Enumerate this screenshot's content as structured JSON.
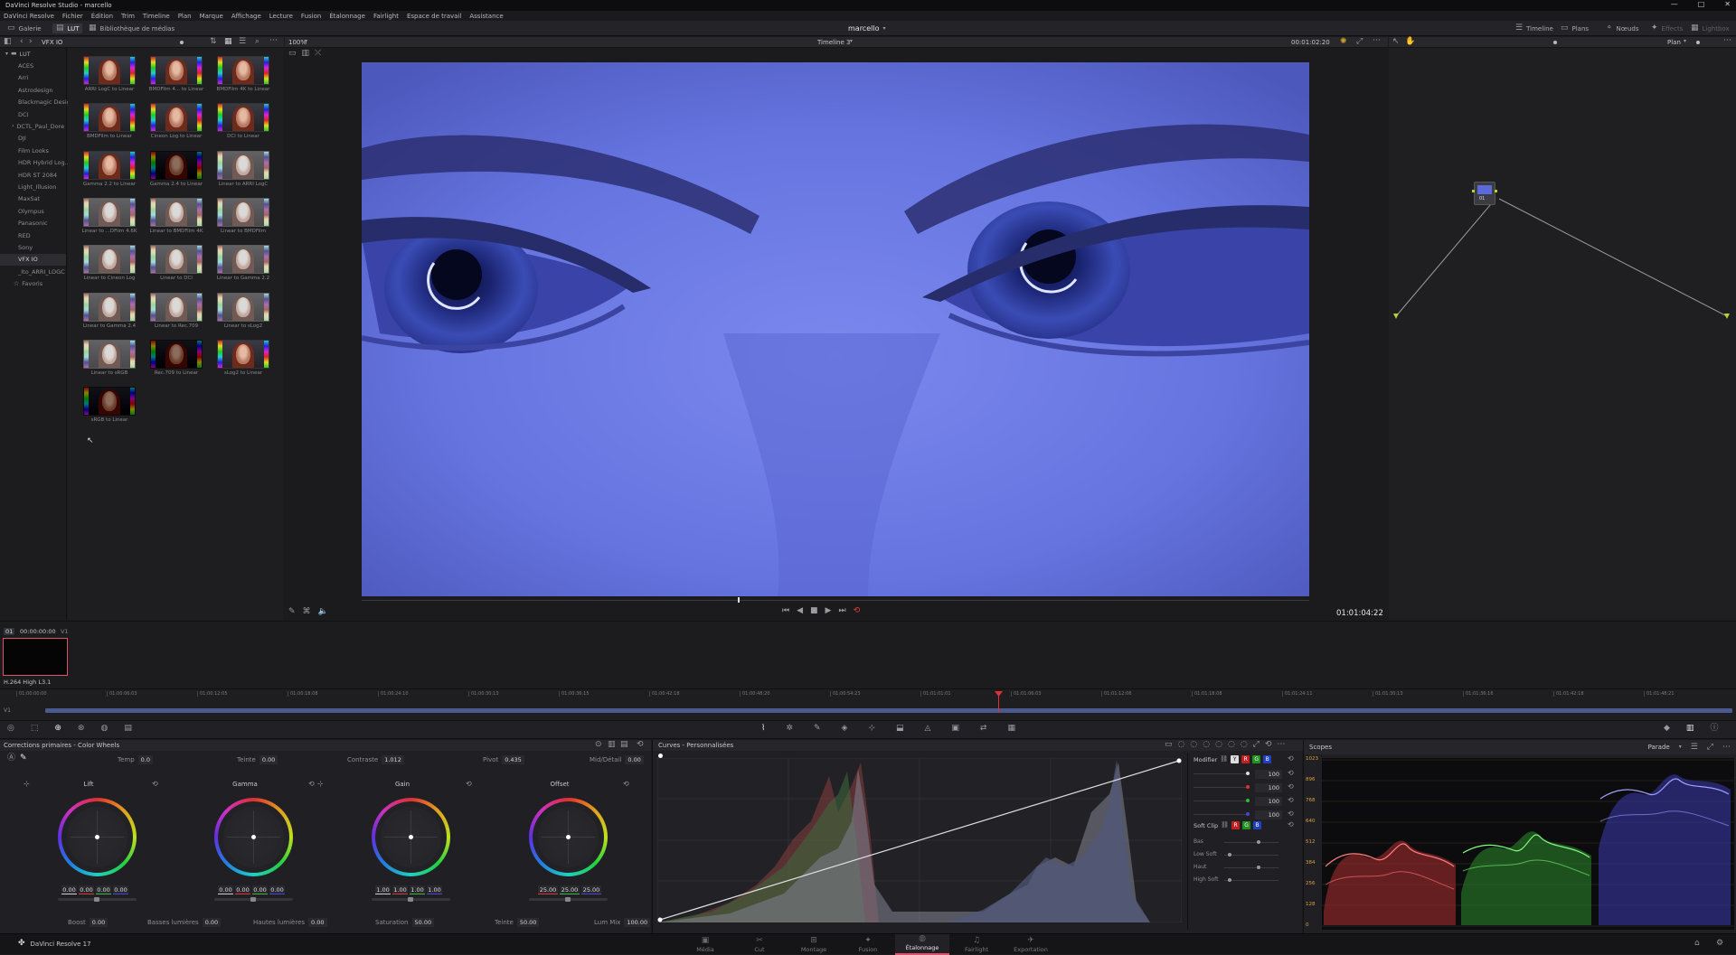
{
  "window": {
    "title": "DaVinci Resolve Studio - marcello",
    "controls": [
      "—",
      "□",
      "✕"
    ]
  },
  "menu": [
    "DaVinci Resolve",
    "Fichier",
    "Édition",
    "Trim",
    "Timeline",
    "Plan",
    "Marque",
    "Affichage",
    "Lecture",
    "Fusion",
    "Étalonnage",
    "Fairlight",
    "Espace de travail",
    "Assistance"
  ],
  "toolbar": {
    "gallery": "Galerie",
    "lut": "LUT",
    "media_library": "Bibliothèque de médias",
    "project_name": "marcello",
    "right": [
      "Timeline",
      "Plans",
      "Nœuds",
      "Effects",
      "Lightbox"
    ]
  },
  "lut_browser": {
    "header": "VFX IO",
    "root": "LUT",
    "folders": [
      "ACES",
      "Arri",
      "Astrodesign",
      "Blackmagic Design",
      "DCI",
      "DCTL_Paul_Dore",
      "DJI",
      "Film Looks",
      "HDR Hybrid Log...",
      "HDR ST 2084",
      "Light_Illusion",
      "MaxSat",
      "Olympus",
      "Panasonic",
      "RED",
      "Sony",
      "VFX IO",
      "_Ito_ARRI_LOGC",
      "Favoris"
    ],
    "selected_folder": "VFX IO",
    "luts": [
      "ARRI LogC to Linear",
      "BMDFilm 4... to Linear",
      "BMDFilm 4K to Linear",
      "BMDFilm to Linear",
      "Cineon Log to Linear",
      "DCI to Linear",
      "Gamma 2.2 to Linear",
      "Gamma 2.4 to Linear",
      "Linear to ARRI LogC",
      "Linear to ...DFilm 4.6K",
      "Linear to BMDFilm 4K",
      "Linear to BMDFilm",
      "Linear to Cineon Log",
      "Linear to DCI",
      "Linear to Gamma 2.2",
      "Linear to Gamma 2.4",
      "Linear to Rec.709",
      "Linear to sLog2",
      "Linear to sRGB",
      "Rec.709 to Linear",
      "sLog2 to Linear",
      "sRGB to Linear"
    ]
  },
  "viewer": {
    "zoom": "100%",
    "timeline_name": "Timeline 3",
    "timecode_top": "00:01:02:20",
    "timecode": "01:01:04:22"
  },
  "nodes": {
    "mode": "Plan",
    "node_label": "01"
  },
  "clip": {
    "index": "01",
    "timecode": "00:00:00:00",
    "track": "V1",
    "codec": "H.264 High L3.1"
  },
  "timeline": {
    "track": "V1",
    "ruler": [
      "01:00:00:00",
      "01:00:06:03",
      "01:00:12:05",
      "01:00:18:08",
      "01:00:24:10",
      "01:00:30:13",
      "01:00:36:15",
      "01:00:42:18",
      "01:00:48:20",
      "01:00:54:23",
      "01:01:01:01",
      "01:01:06:03",
      "01:01:12:06",
      "01:01:18:08",
      "01:01:24:11",
      "01:01:30:13",
      "01:01:36:16",
      "01:01:42:18",
      "01:01:48:21"
    ]
  },
  "primaries": {
    "title": "Corrections primaires - Color Wheels",
    "temp_label": "Temp",
    "temp": "0.0",
    "teinte_label": "Teinte",
    "teinte": "0.00",
    "contraste_label": "Contraste",
    "contraste": "1.012",
    "pivot_label": "Pivot",
    "pivot": "0.435",
    "mid_label": "Mid/Détail",
    "mid": "0.00",
    "wheels": [
      {
        "name": "Lift",
        "values": [
          "0.00",
          "0.00",
          "0.00",
          "0.00"
        ]
      },
      {
        "name": "Gamma",
        "values": [
          "0.00",
          "0.00",
          "0.00",
          "0.00"
        ]
      },
      {
        "name": "Gain",
        "values": [
          "1.00",
          "1.00",
          "1.00",
          "1.00"
        ]
      },
      {
        "name": "Offset",
        "values": [
          "25.00",
          "25.00",
          "25.00"
        ]
      }
    ],
    "boost_label": "Boost",
    "boost": "0.00",
    "shadows_label": "Basses lumières",
    "shadows": "0.00",
    "highlights_label": "Hautes lumières",
    "highlights": "0.00",
    "saturation_label": "Saturation",
    "saturation": "50.00",
    "hue_label": "Teinte",
    "hue": "50.00",
    "lummix_label": "Lum Mix",
    "lummix": "100.00"
  },
  "curves": {
    "title": "Curves - Personnalisées",
    "modifier_label": "Modifier",
    "channel_values": [
      "100",
      "100",
      "100",
      "100"
    ],
    "softclip_label": "Soft Clip",
    "softclip_rows": [
      "Bas",
      "Low Soft",
      "Haut",
      "High Soft"
    ]
  },
  "scopes": {
    "title": "Scopes",
    "mode": "Parade",
    "scale": [
      "1023",
      "896",
      "768",
      "640",
      "512",
      "384",
      "256",
      "128",
      "0"
    ]
  },
  "pages": {
    "app": "DaVinci Resolve 17",
    "tabs": [
      "Média",
      "Cut",
      "Montage",
      "Fusion",
      "Étalonnage",
      "Fairlight",
      "Exportation"
    ],
    "active": "Étalonnage"
  },
  "colors": {
    "accent": "#e0506a",
    "playhead": "#e03030"
  }
}
